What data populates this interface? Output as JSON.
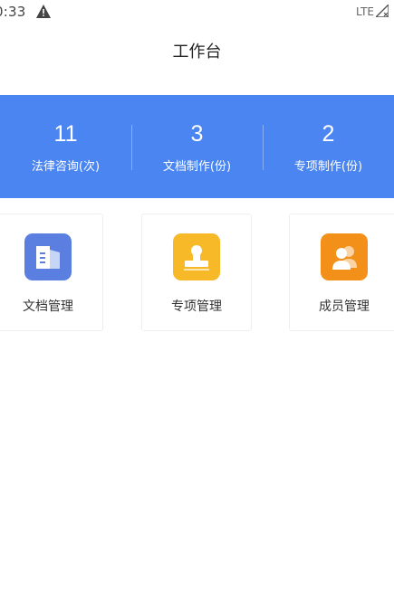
{
  "status_bar": {
    "time": "0:33",
    "network": "LTE",
    "icons": [
      "warning-icon",
      "signal-icon"
    ]
  },
  "header": {
    "title": "工作台"
  },
  "stats": [
    {
      "value": "11",
      "label": "法律咨询(次)"
    },
    {
      "value": "3",
      "label": "文档制作(份)"
    },
    {
      "value": "2",
      "label": "专项制作(份)"
    }
  ],
  "cards": [
    {
      "label": "文档管理",
      "icon": "document-building-icon",
      "color": "#5b7fe0"
    },
    {
      "label": "专项管理",
      "icon": "stamp-icon",
      "color": "#f7b928"
    },
    {
      "label": "成员管理",
      "icon": "members-icon",
      "color": "#f39019"
    }
  ],
  "colors": {
    "accent": "#4a85f1",
    "background": "#ffffff"
  }
}
